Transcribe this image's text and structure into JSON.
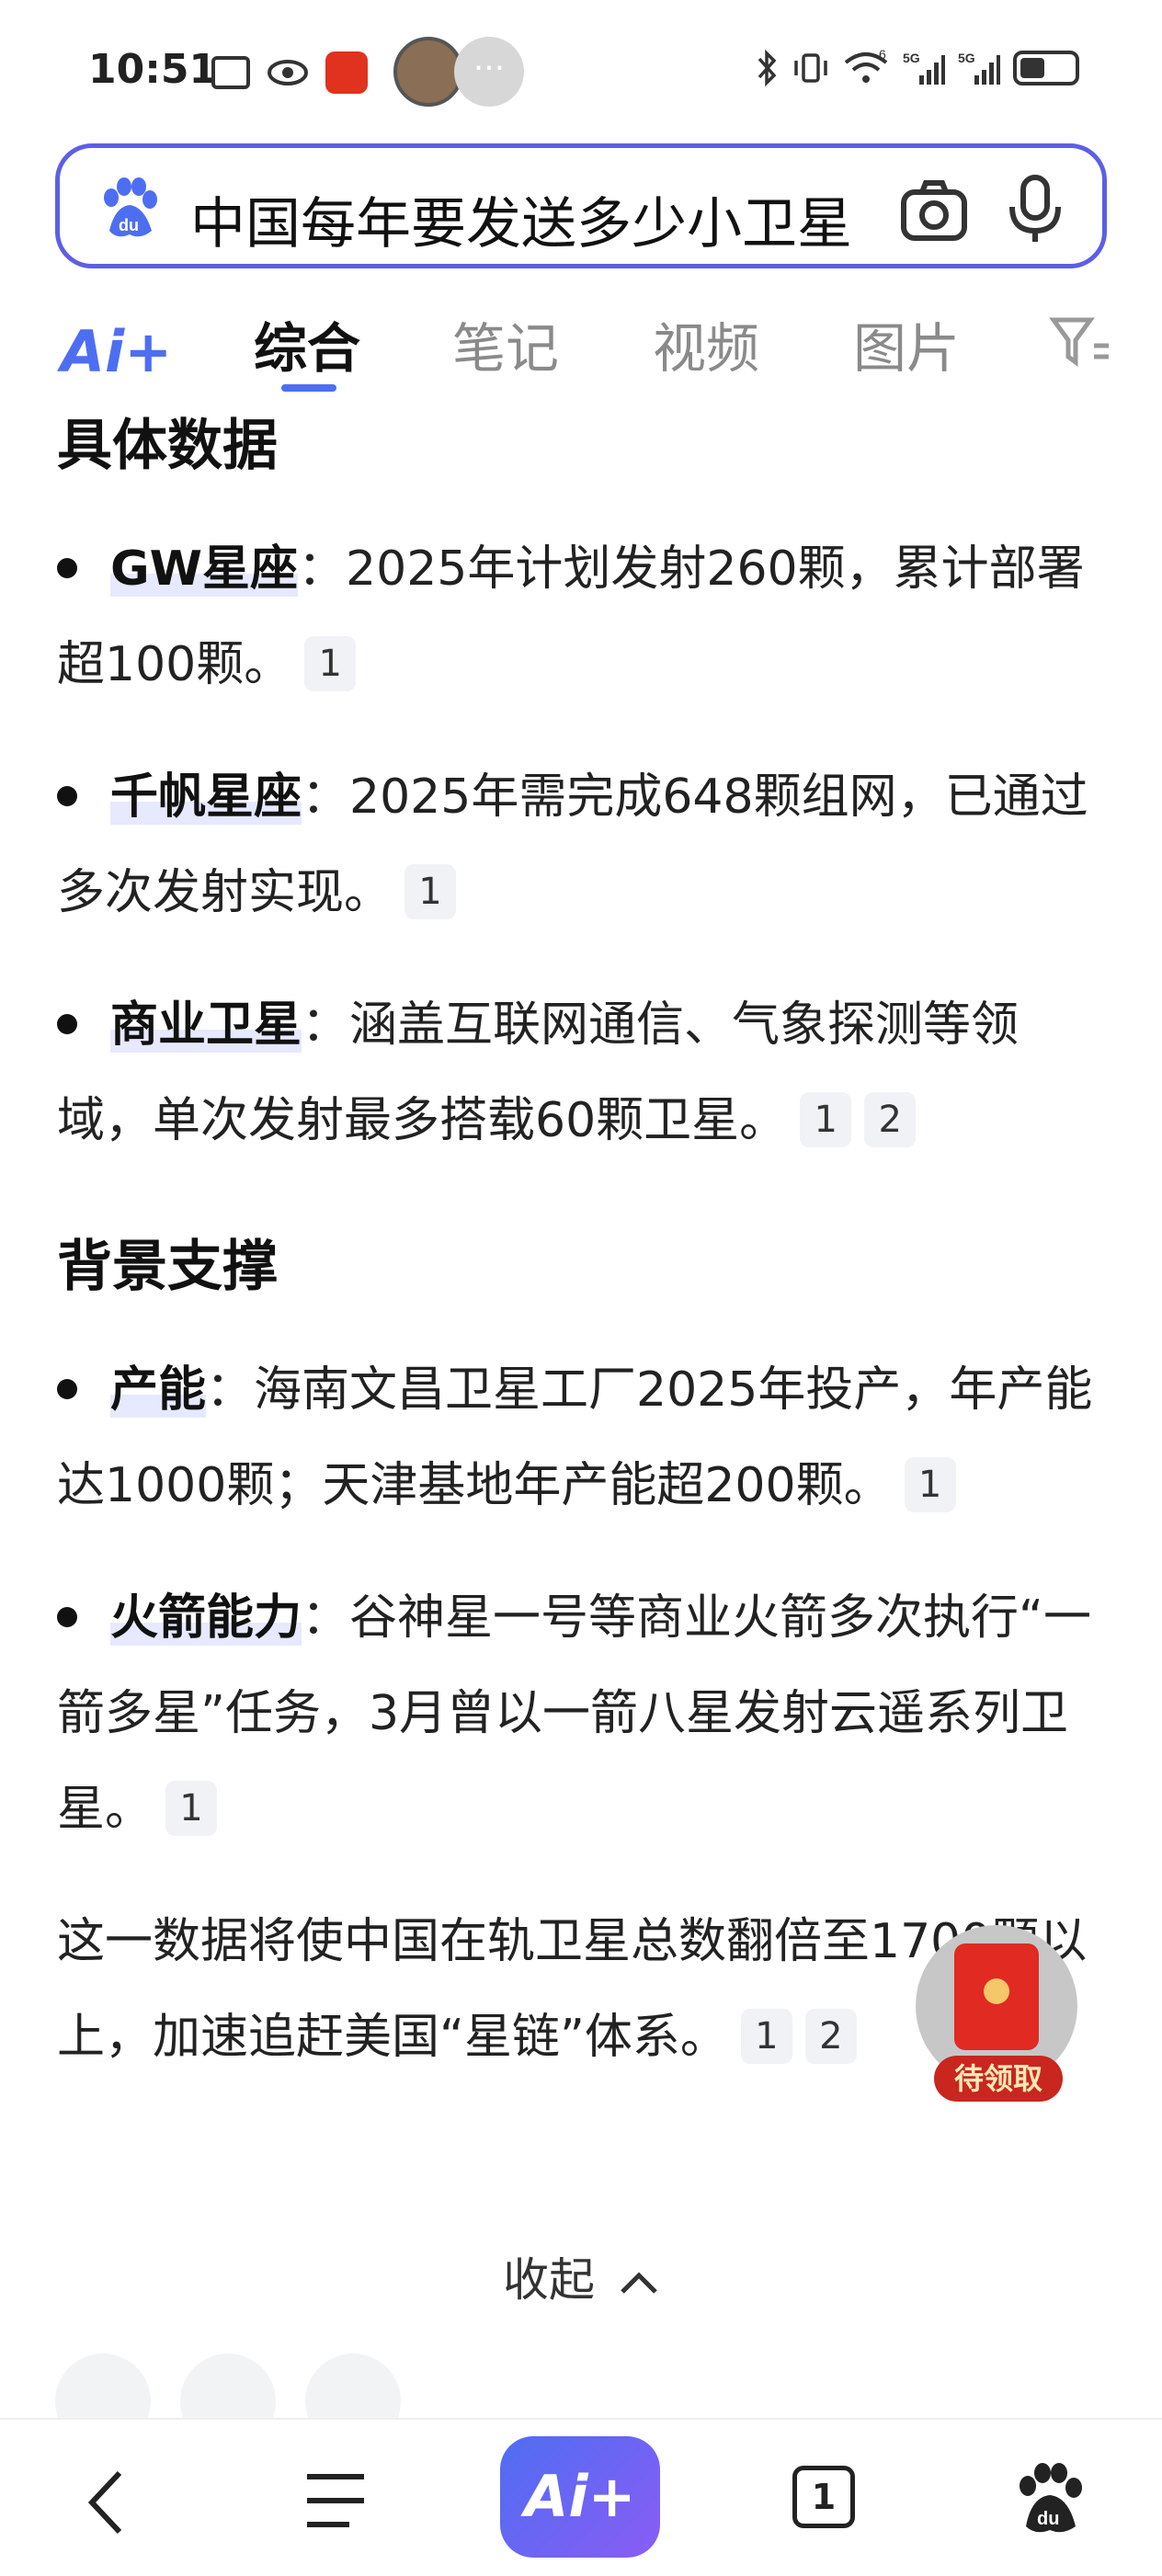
{
  "status_bar": {
    "time": "10:51",
    "network_1": "5G",
    "network_2": "5G",
    "wifi_badge": "6"
  },
  "search": {
    "query": "中国每年要发送多少小卫星"
  },
  "tabs": {
    "ai": "Ai+",
    "items": [
      "综合",
      "笔记",
      "视频",
      "图片"
    ]
  },
  "content": {
    "section1_title": "具体数据",
    "items1": [
      {
        "keyword": "GW星座",
        "text": "：2025年计划发射260颗，累计部署超100颗。",
        "cites": [
          "1"
        ]
      },
      {
        "keyword": "千帆星座",
        "text": "：2025年需完成648颗组网，已通过多次发射实现。",
        "cites": [
          "1"
        ]
      },
      {
        "keyword": "商业卫星",
        "text": "：涵盖互联网通信、气象探测等领域，单次发射最多搭载60颗卫星。",
        "cites": [
          "1",
          "2"
        ]
      }
    ],
    "section2_title": "背景支撑",
    "items2": [
      {
        "keyword": "产能",
        "text": "：海南文昌卫星工厂2025年投产，年产能达1000颗；天津基地年产能超200颗。",
        "cites": [
          "1"
        ]
      },
      {
        "keyword": "火箭能力",
        "text": "：谷神星一号等商业火箭多次执行“一箭多星”任务，3月曾以一箭八星发射云遥系列卫星。",
        "cites": [
          "1"
        ]
      }
    ],
    "summary": "这一数据将使中国在轨卫星总数翻倍至1700颗以上，加速追赶美国“星链”体系。",
    "summary_cites": [
      "1",
      "2"
    ],
    "collapse_label": "收起"
  },
  "floating": {
    "redpacket_label": "待领取"
  },
  "bottom_nav": {
    "ai_label": "Ai+",
    "tab_count": "1"
  },
  "colors": {
    "accent": "#4e6ef2",
    "search_border": "#5c5fe6",
    "redpacket": "#e02a22"
  }
}
